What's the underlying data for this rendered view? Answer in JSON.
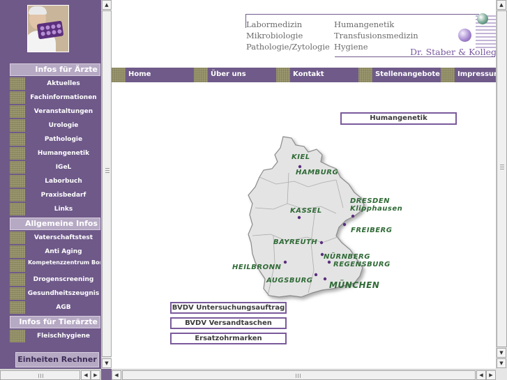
{
  "sidebar": {
    "sections": [
      {
        "header": "Infos für Ärzte",
        "items": [
          "Aktuelles",
          "Fachinformationen",
          "Veranstaltungen",
          "Urologie",
          "Pathologie",
          "Humangenetik",
          "IGeL",
          "Laborbuch",
          "Praxisbedarf",
          "Links"
        ]
      },
      {
        "header": "Allgemeine Infos",
        "items": [
          "Vaterschaftstest",
          "Anti Aging",
          "Kompetenzzentrum Borreliose",
          "Drogenscreening",
          "Gesundheitszeugnis",
          "AGB"
        ]
      },
      {
        "header": "Infos für Tierärzte",
        "items": [
          "Fleischhygiene"
        ]
      }
    ],
    "einheiten": "Einheiten Rechner"
  },
  "logo": {
    "col1": [
      "Labormedizin",
      "Mikrobiologie",
      "Pathologie/Zytologie"
    ],
    "col2": [
      "Humangenetik",
      "Transfusionsmedizin",
      "Hygiene"
    ],
    "brand": "Dr. Staber & Kollegen"
  },
  "topnav": [
    "Home",
    "Über uns",
    "Kontakt",
    "Stellenangebote",
    "Impressum"
  ],
  "humangenetik_button": "Humangenetik",
  "buttons": [
    "BVDV Untersuchungsauftrag",
    "BVDV Versandtaschen",
    "Ersatzohrmarken"
  ],
  "map": {
    "cities": [
      "KIEL",
      "HAMBURG",
      "DRESDEN",
      "Klipphausen",
      "KASSEL",
      "FREIBERG",
      "BAYREUTH",
      "NÜRNBERG",
      "REGENSBURG",
      "HEILBRONN",
      "AUGSBURG",
      "MÜNCHEN"
    ]
  },
  "colors": {
    "sidebar": "#6f5988",
    "nav": "#6f5a8a",
    "accent": "#7a5a9c",
    "map_label": "#2f6a36"
  }
}
